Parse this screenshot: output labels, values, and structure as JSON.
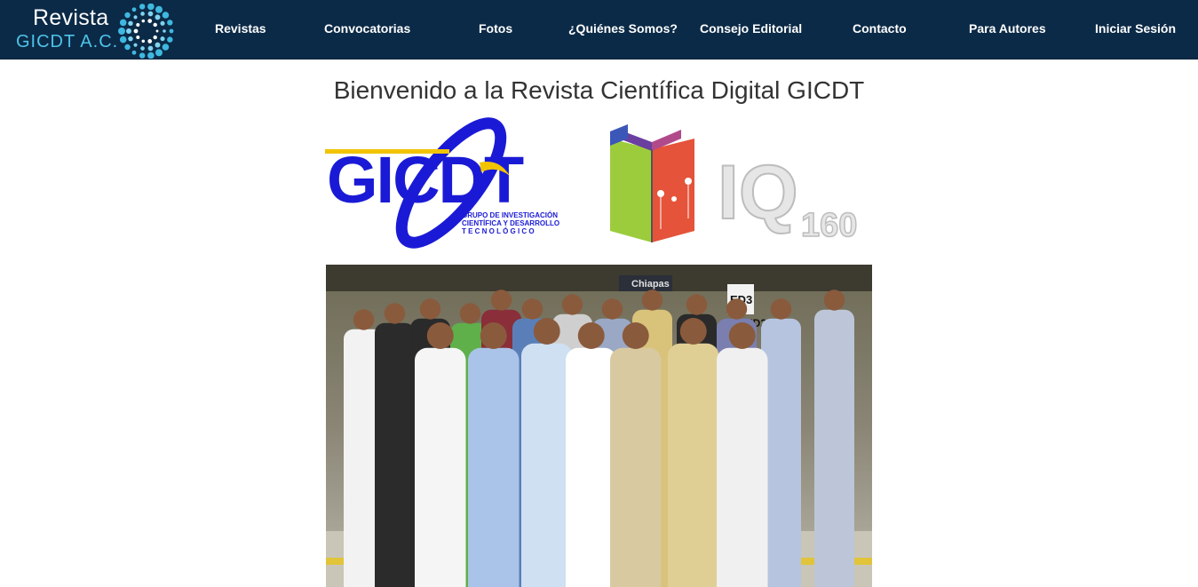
{
  "brand": {
    "line1": "Revista",
    "line2": "GICDT A.C."
  },
  "nav": [
    {
      "label": "Revistas"
    },
    {
      "label": "Convocatorias"
    },
    {
      "label": "Fotos"
    },
    {
      "label": "¿Quiénes Somos?"
    },
    {
      "label": "Consejo Editorial"
    },
    {
      "label": "Contacto"
    },
    {
      "label": "Para Autores"
    },
    {
      "label": "Iniciar Sesión"
    }
  ],
  "main": {
    "title": "Bienvenido a la Revista Científica Digital GICDT",
    "logo_gicdt": {
      "letters": "GICDT",
      "tag1": "GRUPO DE INVESTIGACIÓN",
      "tag2": "CIENTÍFICA Y DESARROLLO",
      "tag3": "T E C N O L Ó G I C O"
    },
    "logo_iq": "IQ",
    "logo_iq_num": "160",
    "photo_sign": "Chiapas",
    "photo_sign2": "ED3",
    "photo_sign3": "ED1 ED2"
  },
  "colors": {
    "nav_bg": "#0b2a47",
    "brand_accent": "#4fc3e8",
    "gicdt_blue": "#1a1ad6",
    "gicdt_yellow": "#f2c400"
  }
}
